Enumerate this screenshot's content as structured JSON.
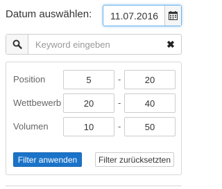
{
  "date": {
    "label": "Datum auswählen:",
    "value": "11.07.2016",
    "icon": "calendar-icon"
  },
  "search": {
    "icon": "search-icon",
    "placeholder": "Keyword eingeben",
    "value": "",
    "clear_label": "✖"
  },
  "filters": {
    "rows": [
      {
        "label": "Position",
        "min": "5",
        "max": "20"
      },
      {
        "label": "Wettbewerb",
        "min": "20",
        "max": "40"
      },
      {
        "label": "Volumen",
        "min": "10",
        "max": "50"
      }
    ],
    "separator": "-",
    "apply_label": "Filter anwenden",
    "reset_label": "Filter zurücksetzten"
  },
  "colors": {
    "accent": "#1a73c9",
    "focus_border": "#66afe9"
  }
}
